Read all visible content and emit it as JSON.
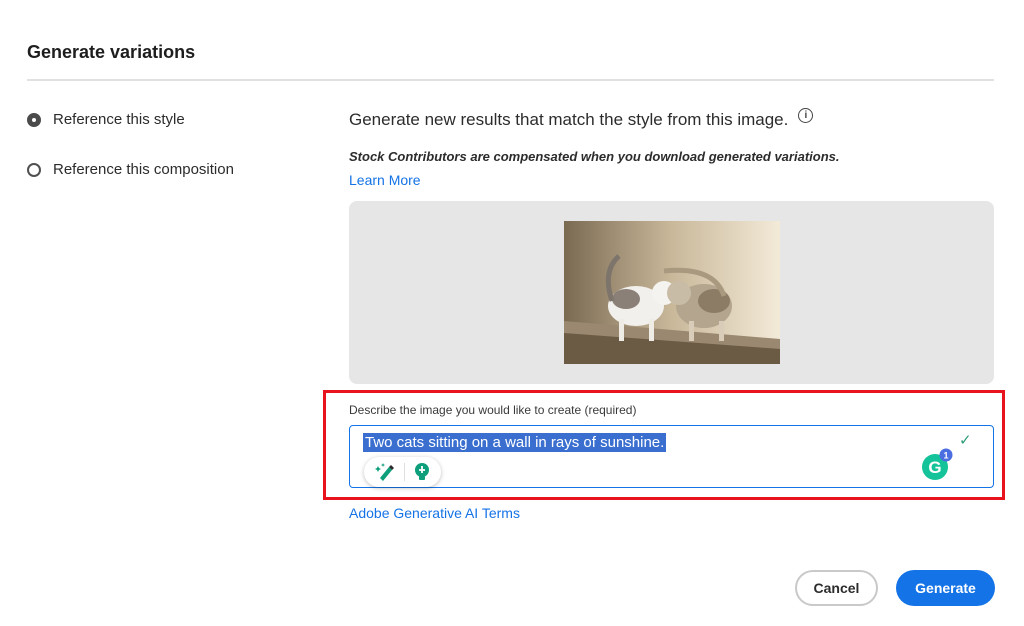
{
  "dialog": {
    "title": "Generate variations"
  },
  "options": [
    {
      "label": "Reference this style",
      "selected": true
    },
    {
      "label": "Reference this composition",
      "selected": false
    }
  ],
  "main": {
    "description": "Generate new results that match the style from this image.",
    "info_icon": "info-icon",
    "notice": "Stock Contributors are compensated when you download generated variations.",
    "learn_more": "Learn More"
  },
  "prompt": {
    "label": "Describe the image you would like to create (required)",
    "value": "Two cats sitting on a wall in rays of sunshine.",
    "grammarly_badge": "1"
  },
  "terms_link": "Adobe Generative AI Terms",
  "buttons": {
    "cancel": "Cancel",
    "generate": "Generate"
  },
  "colors": {
    "accent": "#1473e6",
    "highlight_box": "#e8131c",
    "selection": "#3a6fd0",
    "check": "#2d9d78"
  }
}
